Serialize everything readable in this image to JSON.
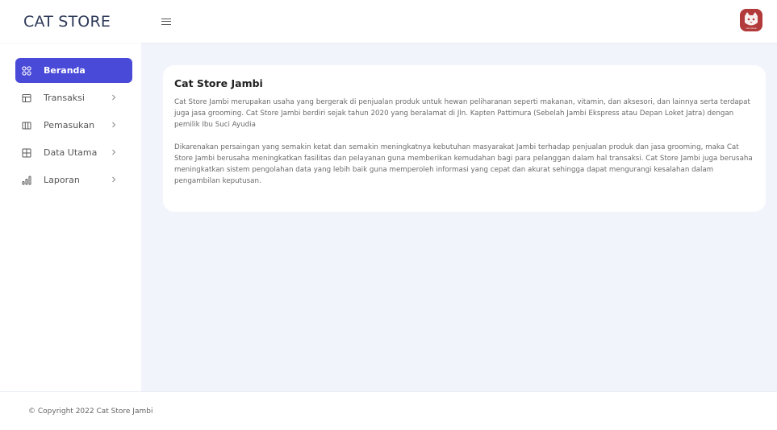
{
  "header": {
    "brand": "CAT STORE",
    "avatar_label": "cat store"
  },
  "sidebar": {
    "items": [
      {
        "label": "Beranda",
        "icon": "grid-icon",
        "active": true
      },
      {
        "label": "Transaksi",
        "icon": "table-icon",
        "active": false
      },
      {
        "label": "Pemasukan",
        "icon": "columns-icon",
        "active": false
      },
      {
        "label": "Data Utama",
        "icon": "grid-plus-icon",
        "active": false
      },
      {
        "label": "Laporan",
        "icon": "bar-chart-icon",
        "active": false
      }
    ]
  },
  "main": {
    "title": "Cat Store Jambi",
    "paragraph1": "Cat Store Jambi merupakan usaha yang bergerak di penjualan produk untuk hewan peliharanan seperti makanan, vitamin, dan aksesori, dan lainnya serta terdapat juga jasa grooming. Cat Store Jambi berdiri sejak tahun 2020 yang beralamat di Jln. Kapten Pattimura (Sebelah Jambi Ekspress atau Depan Loket Jatra) dengan pemilik Ibu Suci Ayudia",
    "paragraph2": "Dikarenakan persaingan yang semakin ketat dan semakin meningkatnya kebutuhan masyarakat Jambi terhadap penjualan produk dan jasa grooming, maka Cat Store Jambi berusaha meningkatkan fasilitas dan pelayanan guna memberikan kemudahan bagi para pelanggan dalam hal transaksi. Cat Store Jambi juga berusaha meningkatkan sistem pengolahan data yang lebih baik guna memperoleh informasi yang cepat dan akurat sehingga dapat mengurangi kesalahan dalam pengambilan keputusan."
  },
  "footer": {
    "copyright": "© Copyright 2022 Cat Store Jambi"
  },
  "colors": {
    "accent": "#4a4ad8",
    "background": "#f1f4fb",
    "avatar": "#b23a3a"
  }
}
